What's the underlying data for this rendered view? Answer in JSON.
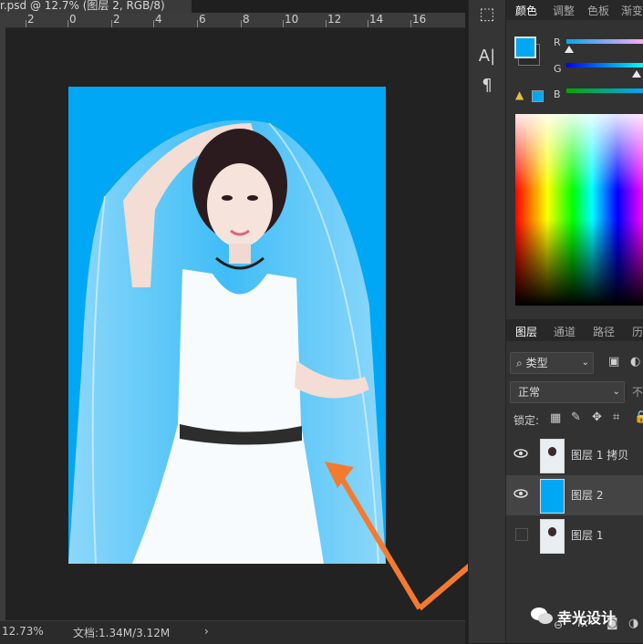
{
  "document": {
    "tab_title": "r.psd @ 12.7% (图层 2, RGB/8)",
    "ruler_marks": [
      "2",
      "0",
      "2",
      "4",
      "6",
      "8",
      "10",
      "12",
      "14",
      "16"
    ]
  },
  "status_bar": {
    "zoom": "12.73%",
    "doc_size": "文档:1.34M/3.12M"
  },
  "color_panel": {
    "tabs": [
      "颜色",
      "调整",
      "色板",
      "渐变"
    ],
    "channels": [
      "R",
      "G",
      "B"
    ],
    "foreground_color": "#00a7f4",
    "background_color": "#2a2a2a"
  },
  "layers_panel": {
    "tabs": [
      "图层",
      "通道",
      "路径",
      "历"
    ],
    "filter_kind": "类型",
    "blend_mode": "正常",
    "opacity_label": "不",
    "lock_label": "锁定:",
    "layers": [
      {
        "name": "图层 1 拷贝",
        "visible": true,
        "thumb": "photo"
      },
      {
        "name": "图层 2",
        "visible": true,
        "thumb": "blue",
        "selected": true
      },
      {
        "name": "图层 1",
        "visible": false,
        "thumb": "photo"
      }
    ]
  },
  "watermark": {
    "text": "幸光设计"
  },
  "annotation": {
    "arrow_color": "#f47a30"
  }
}
